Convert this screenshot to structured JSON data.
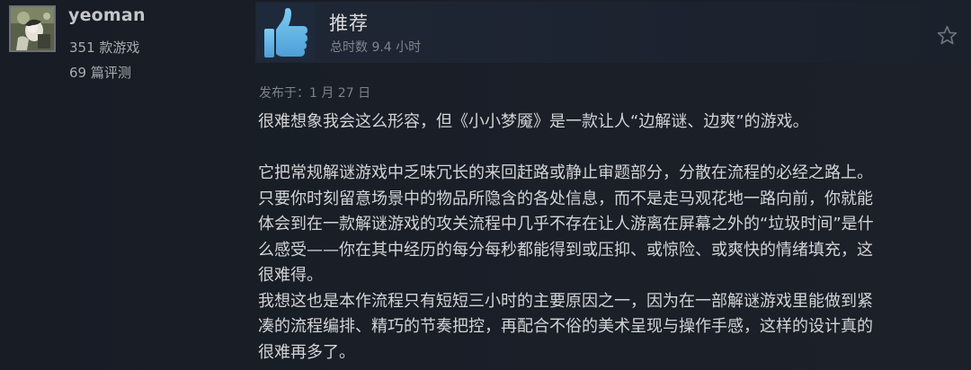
{
  "author": {
    "name": "yeoman",
    "games_owned": "351 款游戏",
    "reviews_count": "69 篇评测",
    "avatar_icon": "user-avatar-icon"
  },
  "review": {
    "verdict": "推荐",
    "hours_label": "总时数 9.4 小时",
    "posted_label": "发布于：1 月 27 日",
    "verdict_icon": "thumbs-up-icon",
    "rate_icon": "star-icon",
    "paragraphs": [
      "很难想象我会这么形容，但《小小梦魇》是一款让人“边解谜、边爽”的游戏。",
      "",
      "它把常规解谜游戏中乏味冗长的来回赶路或静止审题部分，分散在流程的必经之路上。\n只要你时刻留意场景中的物品所隐含的各处信息，而不是走马观花地一路向前，你就能\n体会到在一款解谜游戏的攻关流程中几乎不存在让人游离在屏幕之外的“垃圾时间”是什\n么感受——你在其中经历的每分每秒都能得到或压抑、或惊险、或爽快的情绪填充，这\n很难得。",
      "我想这也是本作流程只有短短三小时的主要原因之一，因为在一部解谜游戏里能做到紧\n凑的流程编排、精巧的节奏把控，再配合不俗的美术呈现与操作手感，这样的设计真的\n很难再多了。"
    ]
  },
  "colors": {
    "background": "#161b24",
    "header": "#1f2734",
    "thumb_blue": "#66c0f4",
    "text": "#d3d4d6",
    "muted": "#7e8389"
  }
}
